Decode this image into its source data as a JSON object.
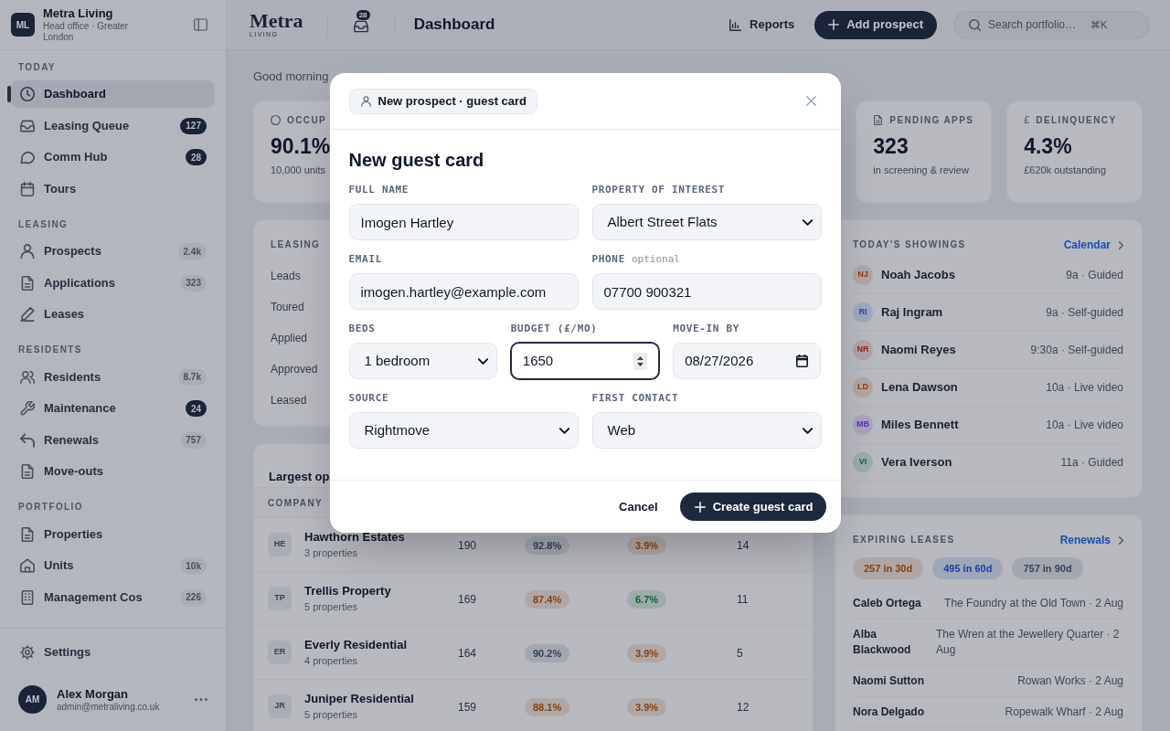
{
  "sidebar": {
    "brand": {
      "initials": "ML",
      "name": "Metra Living",
      "subtitle": "Head office · Greater London"
    },
    "sections": [
      {
        "title": "TODAY",
        "items": [
          {
            "label": "Dashboard",
            "selected": true
          },
          {
            "label": "Leasing Queue",
            "selected": false,
            "badge": {
              "text": "127",
              "strong": true
            }
          },
          {
            "label": "Comm Hub",
            "selected": false,
            "badge": {
              "text": "28",
              "strong": true
            }
          },
          {
            "label": "Tours",
            "selected": false
          }
        ]
      },
      {
        "title": "LEASING",
        "items": [
          {
            "label": "Prospects",
            "selected": false,
            "badge": {
              "text": "2.4k",
              "strong": false
            }
          },
          {
            "label": "Applications",
            "selected": false,
            "badge": {
              "text": "323",
              "strong": false
            }
          },
          {
            "label": "Leases",
            "selected": false
          }
        ]
      },
      {
        "title": "RESIDENTS",
        "items": [
          {
            "label": "Residents",
            "selected": false,
            "badge": {
              "text": "8.7k",
              "strong": false
            }
          },
          {
            "label": "Maintenance",
            "selected": false,
            "badge": {
              "text": "24",
              "strong": true
            }
          },
          {
            "label": "Renewals",
            "selected": false,
            "badge": {
              "text": "757",
              "strong": false
            }
          },
          {
            "label": "Move-outs",
            "selected": false
          }
        ]
      },
      {
        "title": "PORTFOLIO",
        "items": [
          {
            "label": "Properties",
            "selected": false
          },
          {
            "label": "Units",
            "selected": false,
            "badge": {
              "text": "10k",
              "strong": false
            }
          },
          {
            "label": "Management Cos",
            "selected": false,
            "badge": {
              "text": "226",
              "strong": false
            }
          }
        ]
      }
    ],
    "settings": {
      "label": "Settings",
      "selected": false
    },
    "user": {
      "initials": "AM",
      "name": "Alex Morgan",
      "email": "admin@metraliving.co.uk"
    }
  },
  "topbar": {
    "logo": {
      "wordmark": "Metra",
      "tagline": "LIVING"
    },
    "inbox_badge": "28",
    "title": "Dashboard",
    "reports": "Reports",
    "add_prospect": "Add prospect",
    "search": {
      "placeholder": "Search portfolio…",
      "shortcut": "⌘K"
    }
  },
  "dashboard": {
    "greeting": "Good morning",
    "stats_left": [
      {
        "label": "OCCUP",
        "value": "90.1%",
        "note": "10,000 units"
      }
    ],
    "stats_right": [
      {
        "label": "PENDING APPS",
        "value": "323",
        "note": "in screening & review"
      },
      {
        "symbol": "£",
        "label": "DELINQUENCY",
        "value": "4.3%",
        "note": "£620k outstanding"
      }
    ],
    "leasing_funnel": {
      "title": "LEASING",
      "rows": [
        "Leads",
        "Toured",
        "Applied",
        "Approved",
        "Leased"
      ]
    },
    "operators": {
      "title": "Largest op",
      "columns": [
        "COMPANY"
      ],
      "rows": [
        {
          "initials": "HE",
          "name": "Hawthorn Estates",
          "properties": "3 properties",
          "column_2": "190",
          "column_3": {
            "text": "92.8%",
            "color": "#364256"
          },
          "column_4": {
            "text": "3.9%",
            "color": "#834113"
          },
          "column_5": "14"
        },
        {
          "initials": "TP",
          "name": "Trellis Property",
          "properties": "5 properties",
          "column_2": "169",
          "column_3": {
            "text": "87.4%",
            "color": "#834113"
          },
          "column_4": {
            "text": "6.7%",
            "color": "#136137"
          },
          "column_5": "11"
        },
        {
          "initials": "ER",
          "name": "Everly Residential",
          "properties": "4 properties",
          "column_2": "164",
          "column_3": {
            "text": "90.2%",
            "color": "#364256"
          },
          "column_4": {
            "text": "3.9%",
            "color": "#834113"
          },
          "column_5": "5"
        },
        {
          "initials": "JR",
          "name": "Juniper Residential",
          "properties": "5 properties",
          "column_2": "159",
          "column_3": {
            "text": "88.1%",
            "color": "#834113"
          },
          "column_4": {
            "text": "3.9%",
            "color": "#834113"
          },
          "column_5": "12"
        }
      ]
    },
    "showings": {
      "title": "TODAY'S SHOWINGS",
      "link": "Calendar",
      "rows": [
        {
          "initials": "NJ",
          "color": "#8f3a10",
          "name": "Noah Jacobs",
          "detail": "9a · Guided"
        },
        {
          "initials": "RI",
          "color": "#1e4cb1",
          "name": "Raj Ingram",
          "detail": "9a · Self-guided"
        },
        {
          "initials": "NR",
          "color": "#93202a",
          "name": "Naomi Reyes",
          "detail": "9:30a · Self-guided"
        },
        {
          "initials": "LD",
          "color": "#8f3a10",
          "name": "Lena Dawson",
          "detail": "10a · Live video"
        },
        {
          "initials": "MB",
          "color": "#5b30b3",
          "name": "Miles Bennett",
          "detail": "10a · Live video"
        },
        {
          "initials": "VI",
          "color": "#0d6030",
          "name": "Vera Iverson",
          "detail": "11a · Guided"
        }
      ]
    },
    "expiring_leases": {
      "title": "EXPIRING LEASES",
      "link": "Renewals",
      "chips": [
        {
          "text": "257 in 30d",
          "color": "#834113"
        },
        {
          "text": "495 in 60d",
          "color": "#193ea4"
        },
        {
          "text": "757 in 90d",
          "color": "#364256"
        }
      ],
      "rows": [
        {
          "name": "Caleb Ortega",
          "detail": "The Foundry at the Old Town · 2 Aug"
        },
        {
          "name": "Alba Blackwood",
          "detail": "The Wren at the Jewellery Quarter · 2 Aug"
        },
        {
          "name": "Naomi Sutton",
          "detail": "Rowan Works · 2 Aug"
        },
        {
          "name": "Nora Delgado",
          "detail": "Ropewalk Wharf · 2 Aug"
        }
      ]
    }
  },
  "dialog": {
    "tag": "New prospect · guest card",
    "title": "New guest card",
    "field_rows": [
      [
        {
          "label": "FULL NAME",
          "kind": "text",
          "value": "Imogen Hartley",
          "focused": false
        },
        {
          "label": "PROPERTY OF INTEREST",
          "kind": "select",
          "value": "Albert Street Flats",
          "focused": false
        }
      ],
      [
        {
          "label": "EMAIL",
          "kind": "text",
          "value": "imogen.hartley@example.com",
          "focused": false
        },
        {
          "label": "PHONE",
          "note": "optional",
          "kind": "text",
          "value": "07700 900321",
          "focused": false
        }
      ],
      [
        {
          "label": "BEDS",
          "kind": "select",
          "value": "1 bedroom",
          "focused": false
        },
        {
          "label": "BUDGET (£/MO)",
          "kind": "number",
          "value": "1650",
          "focused": true
        },
        {
          "label": "MOVE-IN BY",
          "kind": "date",
          "value": "08/27/2026",
          "focused": false
        }
      ],
      [
        {
          "label": "SOURCE",
          "kind": "select",
          "value": "Rightmove",
          "focused": false
        },
        {
          "label": "FIRST CONTACT",
          "kind": "select",
          "value": "Web",
          "focused": false
        }
      ]
    ],
    "actions": {
      "cancel": "Cancel",
      "submit": "Create guest card"
    }
  }
}
